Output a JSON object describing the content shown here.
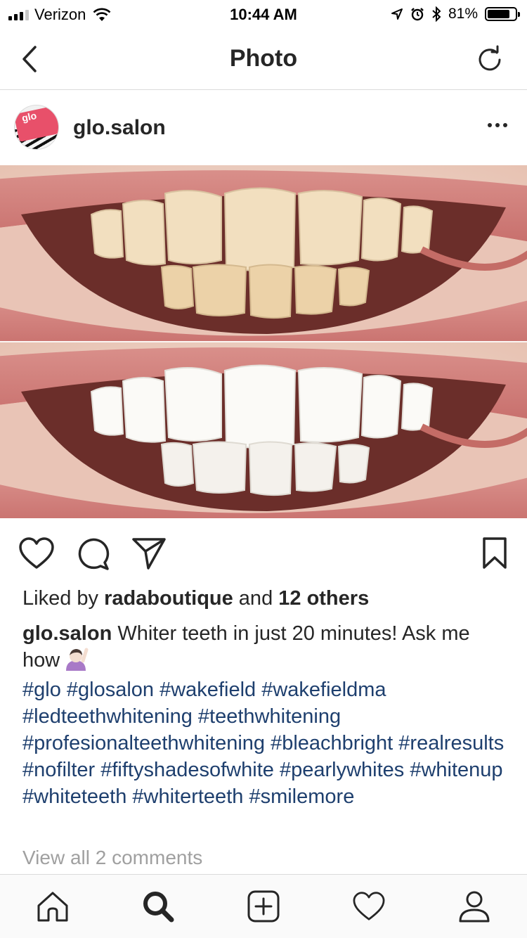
{
  "status_bar": {
    "carrier": "Verizon",
    "time": "10:44 AM",
    "battery": "81%",
    "battery_level": 0.81
  },
  "nav": {
    "title": "Photo",
    "back_icon": "chevron-left-icon",
    "refresh_icon": "refresh-icon"
  },
  "post": {
    "username": "glo.salon",
    "avatar_text": "glo",
    "photo_alt": "Before and after teeth whitening comparison",
    "likes": {
      "prefix": "Liked by ",
      "user": "radaboutique",
      "middle": " and ",
      "others": "12 others"
    },
    "caption": {
      "user": "glo.salon",
      "text": " Whiter teeth in just 20 minutes! Ask me how"
    },
    "hashtags": [
      "#glo",
      "#glosalon",
      "#wakefield",
      "#wakefieldma",
      "#ledteethwhitening",
      "#teethwhitening",
      "#profesionalteethwhitening",
      "#bleachbright",
      "#realresults",
      "#nofilter",
      "#fiftyshadesofwhite",
      "#pearlywhites",
      "#whitenup",
      "#whiteteeth",
      "#whiterteeth",
      "#smilemore"
    ],
    "view_comments": "View all 2 comments"
  },
  "colors": {
    "hashtag": "#1e3f6e",
    "text": "#262626",
    "muted": "#a0a0a0",
    "divider": "#dbdbdb"
  }
}
